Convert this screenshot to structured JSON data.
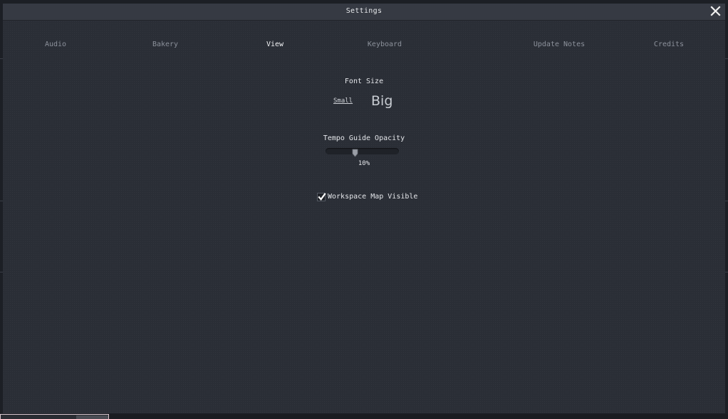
{
  "window": {
    "title": "Settings"
  },
  "tabs": [
    {
      "label": "Audio",
      "active": false
    },
    {
      "label": "Bakery",
      "active": false
    },
    {
      "label": "View",
      "active": true
    },
    {
      "label": "Keyboard",
      "active": false
    },
    {
      "label": "Update Notes",
      "active": false
    },
    {
      "label": "Credits",
      "active": false
    }
  ],
  "view": {
    "font_size": {
      "label": "Font Size",
      "small_label": "Small",
      "big_label": "Big",
      "selected": "Small"
    },
    "tempo_guide_opacity": {
      "label": "Tempo Guide Opacity",
      "value_text": "10%",
      "value_fraction": 0.4
    },
    "workspace_map": {
      "label": "Workspace Map Visible",
      "checked": true
    }
  },
  "icons": {
    "close": "close-icon",
    "check": "checkmark-icon",
    "slider_thumb": "slider-thumb-icon"
  },
  "colors": {
    "window_bg": "#2a2e36",
    "titlebar_bg": "#363a43",
    "active_tab": "#f2f3f5",
    "inactive_tab": "#8c919b",
    "text": "#e4e6ea"
  }
}
